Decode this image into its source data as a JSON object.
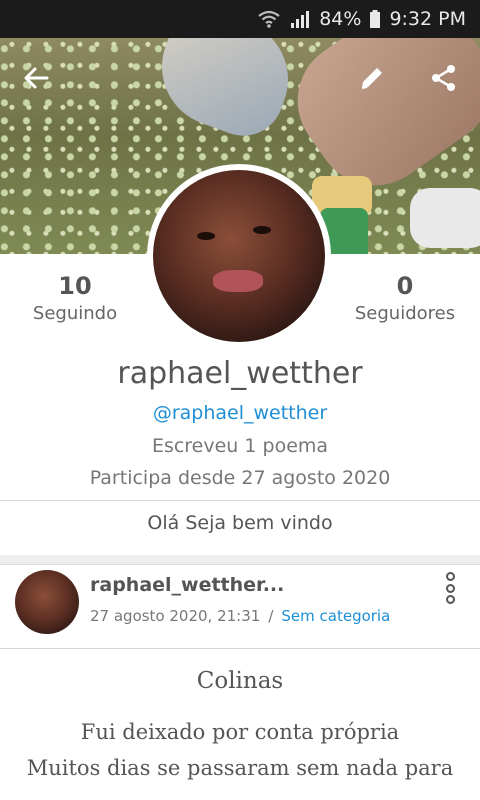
{
  "statusbar": {
    "battery": "84%",
    "time": "9:32 PM"
  },
  "profile": {
    "following_count": "10",
    "following_label": "Seguindo",
    "followers_count": "0",
    "followers_label": "Seguidores",
    "name": "raphael_wetther",
    "handle": "@raphael_wetther",
    "poems": "Escreveu 1 poema",
    "joined": "Participa desde 27 agosto 2020",
    "bio": "Olá Seja bem vindo"
  },
  "post": {
    "author": "raphael_wetther...",
    "date": "27 agosto 2020, 21:31",
    "separator": "/",
    "category": "Sem categoria",
    "title": "Colinas",
    "lines": [
      "Fui deixado por conta própria",
      "Muitos dias se passaram sem nada para"
    ]
  },
  "colors": {
    "accent": "#1e8fd6",
    "statusbar": "#1b1b1b"
  },
  "icons": [
    "back-arrow-icon",
    "edit-pencil-icon",
    "share-icon",
    "wifi-icon",
    "signal-icon",
    "battery-icon",
    "more-vertical-icon"
  ]
}
